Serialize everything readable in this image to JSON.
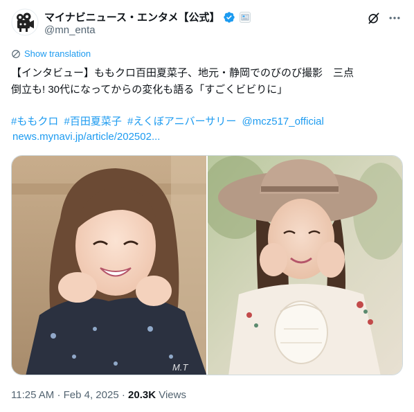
{
  "account": {
    "display_name": "マイナビニュース・エンタメ【公式】",
    "handle": "@mn_enta",
    "verified_badge_color": "#1d9bf0",
    "affiliate_badge_icon": "news-affiliate-badge"
  },
  "actions": {
    "grok_icon": "grok-icon",
    "more_icon": "more-icon"
  },
  "translation": {
    "label": "Show translation"
  },
  "tweet": {
    "text_line1": "【インタビュー】ももクロ百田夏菜子、地元・静岡でのびのび撮影　三点",
    "text_line2": "倒立も! 30代になってからの変化も語る「すごくビビりに」",
    "hashtags": [
      "#ももクロ",
      "#百田夏菜子",
      "#えくぼアニバーサリー"
    ],
    "mention": "@mcz517_official",
    "link": "news.mynavi.jp/article/202502..."
  },
  "media": {
    "watermark": "M.T"
  },
  "meta": {
    "time": "11:25 AM",
    "separator": "·",
    "date": "Feb 4, 2025",
    "views_count": "20.3K",
    "views_label": "Views"
  },
  "colors": {
    "link": "#1d9bf0",
    "secondary_text": "#536471",
    "primary_text": "#0f1419"
  }
}
